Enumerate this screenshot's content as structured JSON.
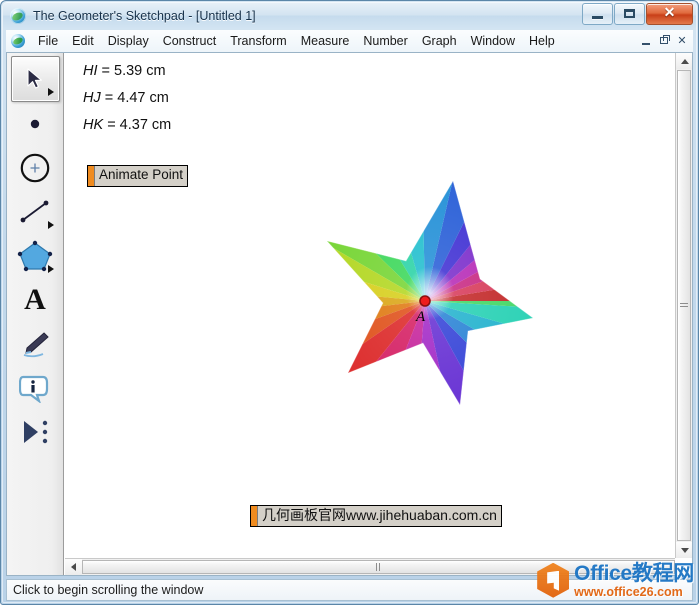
{
  "window": {
    "title": "The Geometer's Sketchpad - [Untitled 1]",
    "app_icon": "sketchpad-globe-icon",
    "caption": {
      "minimize": "minimize-icon",
      "maximize": "maximize-icon",
      "close": "✕"
    }
  },
  "menubar": {
    "icon": "sketchpad-globe-icon",
    "items": [
      {
        "label": "File"
      },
      {
        "label": "Edit"
      },
      {
        "label": "Display"
      },
      {
        "label": "Construct"
      },
      {
        "label": "Transform"
      },
      {
        "label": "Measure"
      },
      {
        "label": "Number"
      },
      {
        "label": "Graph"
      },
      {
        "label": "Window"
      },
      {
        "label": "Help"
      }
    ],
    "mdi": {
      "minimize": "mdi-minimize-icon",
      "restore": "mdi-restore-icon",
      "close": "✕"
    }
  },
  "toolbox": {
    "tools": [
      {
        "name": "arrow-select-tool",
        "icon": "arrow-cursor-icon",
        "selected": true,
        "has_submenu": true
      },
      {
        "name": "point-tool",
        "icon": "point-dot-icon",
        "selected": false,
        "has_submenu": false
      },
      {
        "name": "compass-circle-tool",
        "icon": "circle-compass-icon",
        "selected": false,
        "has_submenu": false
      },
      {
        "name": "straightedge-tool",
        "icon": "line-segment-icon",
        "selected": false,
        "has_submenu": true
      },
      {
        "name": "polygon-tool",
        "icon": "pentagon-icon",
        "selected": false,
        "has_submenu": true
      },
      {
        "name": "text-tool",
        "icon": "letter-a-icon",
        "selected": false,
        "has_submenu": false
      },
      {
        "name": "marker-tool",
        "icon": "marker-pen-icon",
        "selected": false,
        "has_submenu": false
      },
      {
        "name": "information-tool",
        "icon": "info-bubble-icon",
        "selected": false,
        "has_submenu": false
      },
      {
        "name": "custom-tool",
        "icon": "play-arrow-dots-icon",
        "selected": false,
        "has_submenu": false
      }
    ]
  },
  "sketch": {
    "measurements": [
      {
        "label": "HI",
        "value": "= 5.39 cm"
      },
      {
        "label": "HJ",
        "value": "= 4.47 cm"
      },
      {
        "label": "HK",
        "value": "= 4.37 cm"
      }
    ],
    "buttons": [
      {
        "name": "animate-point-button",
        "label": "Animate Point",
        "bar_color": "#ef8b1f"
      },
      {
        "name": "website-link-button",
        "label": "几何画板官网www.jihehuaban.com.cn",
        "bar_color": "#ef8b1f"
      }
    ],
    "star": {
      "name": "rainbow-star-figure",
      "points": 5,
      "center_point_label": "A",
      "center_point_color": "#ee1c1c",
      "ray_colors": [
        "#e8148c",
        "#c118d8",
        "#7a1ae8",
        "#2a35e0",
        "#1a7ae0",
        "#10b8d8",
        "#13d8b0",
        "#2fe057",
        "#8ae024",
        "#d8d81a",
        "#e8b010",
        "#e86a10",
        "#e82020",
        "#e01060",
        "#d010a8"
      ]
    }
  },
  "scrollbars": {
    "vertical": {
      "up": "scroll-up-arrow-icon",
      "down": "scroll-down-arrow-icon"
    },
    "horizontal": {
      "left": "scroll-left-arrow-icon"
    }
  },
  "statusbar": {
    "text": "Click to begin scrolling the window"
  },
  "watermark": {
    "logo": "office-hexagon-logo",
    "top": "Office教程网",
    "bottom": "www.office26.com",
    "top_color": "#1b74c4",
    "bottom_color": "#e2620d"
  }
}
